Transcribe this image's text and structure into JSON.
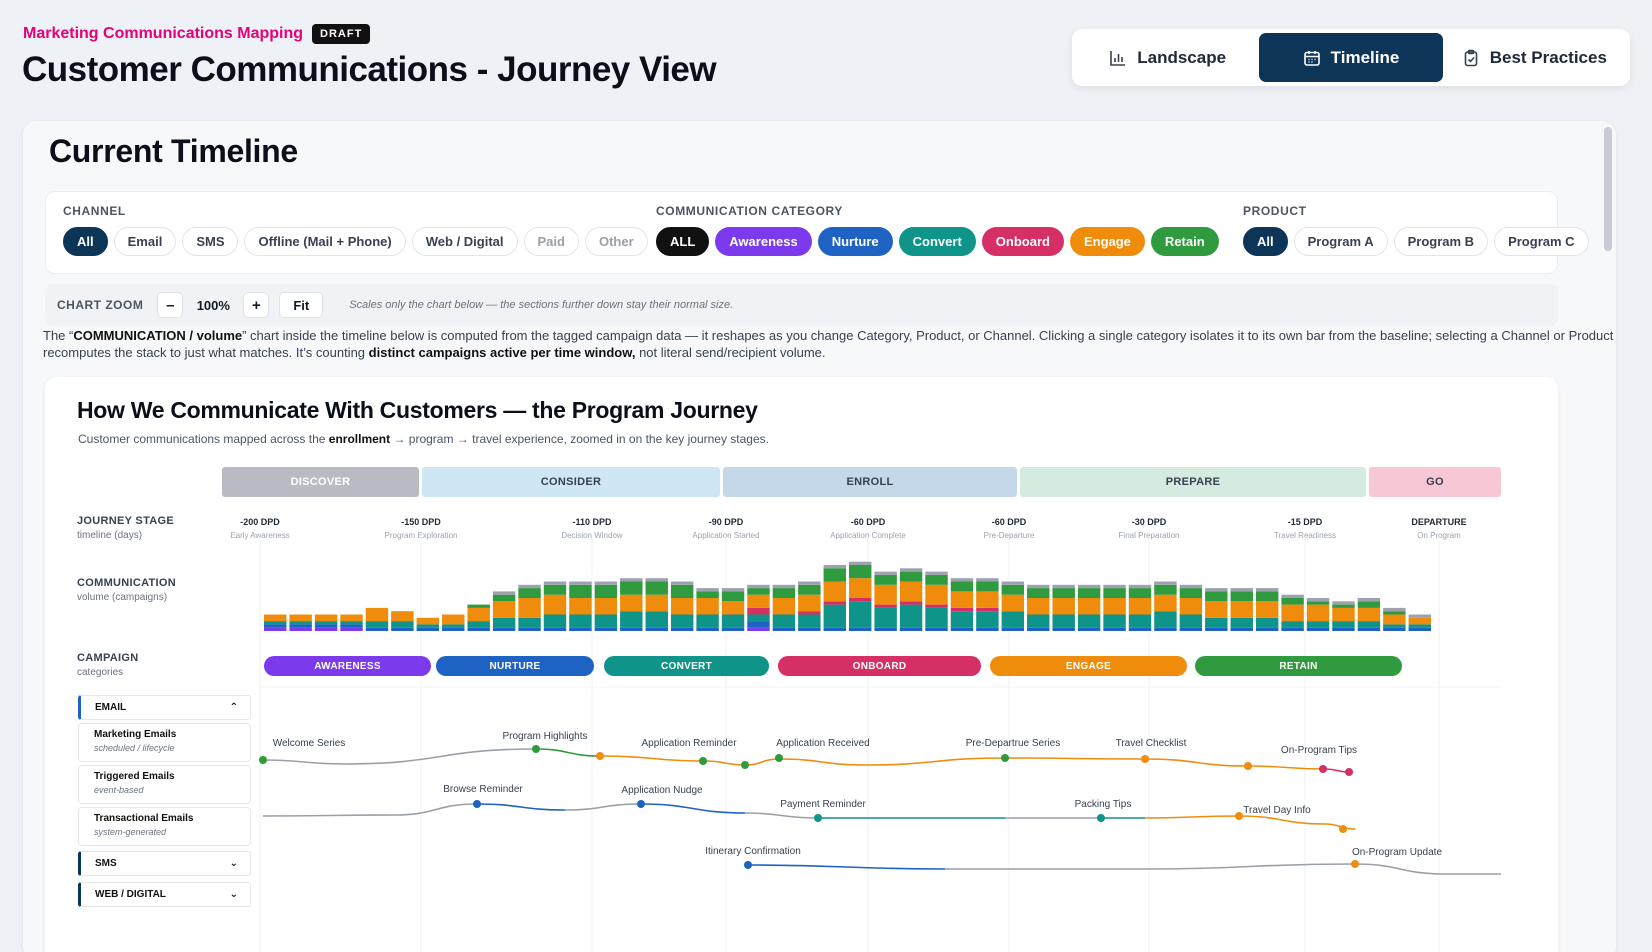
{
  "header": {
    "subtitle": "Marketing Communications Mapping",
    "badge": "DRAFT",
    "title": "Customer Communications - Journey View"
  },
  "views": [
    {
      "label": "Landscape",
      "icon": "bar-chart-icon",
      "active": false
    },
    {
      "label": "Timeline",
      "icon": "calendar-icon",
      "active": true
    },
    {
      "label": "Best Practices",
      "icon": "clipboard-icon",
      "active": false
    }
  ],
  "panel": {
    "title": "Current Timeline"
  },
  "filters": {
    "channel": {
      "label": "CHANNEL",
      "options": [
        "All",
        "Email",
        "SMS",
        "Offline (Mail + Phone)",
        "Web / Digital",
        "Paid",
        "Other"
      ],
      "selected": "All"
    },
    "category": {
      "label": "COMMUNICATION CATEGORY",
      "options": [
        "ALL",
        "Awareness",
        "Nurture",
        "Convert",
        "Onboard",
        "Engage",
        "Retain"
      ],
      "selected": "ALL"
    },
    "product": {
      "label": "PRODUCT",
      "options": [
        "All",
        "Program A",
        "Program B",
        "Program C"
      ],
      "selected": "All"
    }
  },
  "zoom": {
    "label": "CHART ZOOM",
    "minus": "–",
    "value": "100%",
    "plus": "+",
    "fit": "Fit",
    "note": "Scales only the chart below — the sections further down stay their normal size."
  },
  "explain": {
    "p1": "The “",
    "b1": "COMMUNICATION / volume",
    "p2": "” chart inside the timeline below is computed from the tagged campaign data — it reshapes as you change Category, Product, or Channel. Clicking a single category isolates it to its own bar from the baseline; selecting a Channel or Product recomputes the stack to just what matches. It’s counting ",
    "b2": "distinct campaigns active per time window,",
    "p3": " not literal send/recipient volume."
  },
  "chart": {
    "title": "How We Communicate With Customers — the Program Journey",
    "sub_before": "Customer communications mapped across the ",
    "sub_bold": "enrollment",
    "sub_after": " → program → travel experience, zoomed in on the key journey stages.",
    "rows": {
      "journey": {
        "label": "JOURNEY STAGE",
        "sub": "timeline (days)"
      },
      "volume": {
        "label": "COMMUNICATION",
        "sub": "volume (campaigns)"
      },
      "campaign": {
        "label": "CAMPAIGN",
        "sub": "categories"
      }
    },
    "stages": [
      {
        "label": "DISCOVER",
        "bg": "#b8bcc2",
        "fg": "#ffffff"
      },
      {
        "label": "CONSIDER",
        "bg": "#cfe6f5",
        "fg": "#374151"
      },
      {
        "label": "ENROLL",
        "bg": "#c5d8ea",
        "fg": "#374151"
      },
      {
        "label": "PREPARE",
        "bg": "#d5ebe0",
        "fg": "#374151"
      },
      {
        "label": "GO",
        "bg": "#f7c7d6",
        "fg": "#374151"
      }
    ],
    "ticks": [
      {
        "value": "-200 DPD",
        "name": "Early Awareness"
      },
      {
        "value": "-150 DPD",
        "name": "Program Exploration"
      },
      {
        "value": "-110 DPD",
        "name": "Decision Window"
      },
      {
        "value": "-90 DPD",
        "name": "Application Started"
      },
      {
        "value": "-60 DPD",
        "name": "Application Complete"
      },
      {
        "value": "-60 DPD",
        "name": "Pre-Departure"
      },
      {
        "value": "-30 DPD",
        "name": "Final Preparation"
      },
      {
        "value": "-15 DPD",
        "name": "Travel Readiness"
      },
      {
        "value": "DEPARTURE",
        "name": "On Program"
      }
    ],
    "categories": [
      {
        "label": "AWARENESS",
        "color": "#7c3aed"
      },
      {
        "label": "NURTURE",
        "color": "#1e63c4"
      },
      {
        "label": "CONVERT",
        "color": "#0e9488"
      },
      {
        "label": "ONBOARD",
        "color": "#d62f66"
      },
      {
        "label": "ENGAGE",
        "color": "#f08c0c"
      },
      {
        "label": "RETAIN",
        "color": "#2f9a3e"
      }
    ],
    "channels": [
      {
        "label": "EMAIL",
        "open": true,
        "subs": [
          {
            "title": "Marketing Emails",
            "desc": "scheduled / lifecycle"
          },
          {
            "title": "Triggered Emails",
            "desc": "event-based"
          },
          {
            "title": "Transactional Emails",
            "desc": "system-generated"
          }
        ]
      },
      {
        "label": "SMS",
        "open": false,
        "subs": []
      },
      {
        "label": "WEB / DIGITAL",
        "open": false,
        "subs": []
      }
    ],
    "lane_labels": [
      "Welcome Series",
      "Program Highlights",
      "Application Reminder",
      "Application Received",
      "Pre-Departrue Series",
      "Travel Checklist",
      "On-Program Tips",
      "Browse Reminder",
      "Application Nudge",
      "Payment Reminder",
      "Packing Tips",
      "Travel Day Info",
      "Itinerary Confirmation",
      "On-Program Update"
    ]
  },
  "chart_data": {
    "type": "bar",
    "stacked": true,
    "ylabel": "volume (campaigns)",
    "categories_count": 46,
    "series": [
      {
        "name": "Awareness",
        "values": [
          1,
          1,
          1,
          1,
          0,
          0,
          0,
          0,
          0,
          0,
          0,
          0,
          0,
          0,
          0,
          0,
          0,
          0,
          0,
          1,
          0,
          0,
          0,
          0,
          0,
          0,
          0,
          0,
          0,
          0,
          0,
          0,
          0,
          0,
          0,
          0,
          0,
          0,
          0,
          0,
          0,
          0,
          0,
          0,
          0,
          0
        ]
      },
      {
        "name": "Nurture",
        "values": [
          1,
          1,
          1,
          1,
          1,
          1,
          1,
          1,
          1,
          1,
          1,
          1,
          1,
          1,
          1,
          1,
          1,
          1,
          1,
          2,
          1,
          1,
          1,
          1,
          1,
          1,
          1,
          1,
          1,
          1,
          1,
          1,
          1,
          1,
          1,
          1,
          1,
          1,
          1,
          1,
          1,
          1,
          1,
          1,
          1,
          1
        ]
      },
      {
        "name": "Convert",
        "values": [
          1,
          1,
          1,
          1,
          2,
          2,
          1,
          1,
          2,
          3,
          3,
          4,
          4,
          4,
          5,
          5,
          4,
          4,
          4,
          2,
          4,
          4,
          7,
          8,
          6,
          7,
          6,
          5,
          5,
          5,
          4,
          4,
          4,
          4,
          4,
          5,
          4,
          3,
          3,
          3,
          2,
          2,
          2,
          2,
          1,
          1
        ]
      },
      {
        "name": "Onboard",
        "values": [
          0,
          0,
          0,
          0,
          0,
          0,
          0,
          0,
          0,
          0,
          0,
          0,
          0,
          0,
          0,
          0,
          0,
          0,
          0,
          2,
          0,
          1,
          1,
          1,
          1,
          1,
          1,
          1,
          1,
          0,
          0,
          0,
          0,
          0,
          0,
          0,
          0,
          0,
          0,
          0,
          0,
          0,
          0,
          0,
          0,
          0
        ]
      },
      {
        "name": "Engage",
        "values": [
          2,
          2,
          2,
          2,
          4,
          3,
          2,
          3,
          4,
          5,
          6,
          6,
          5,
          5,
          5,
          5,
          5,
          5,
          4,
          4,
          5,
          5,
          6,
          6,
          6,
          6,
          6,
          5,
          5,
          5,
          5,
          5,
          5,
          5,
          5,
          5,
          5,
          5,
          5,
          5,
          5,
          5,
          4,
          4,
          3,
          2
        ]
      },
      {
        "name": "Retain",
        "values": [
          0,
          0,
          0,
          0,
          0,
          0,
          0,
          0,
          1,
          2,
          3,
          3,
          4,
          4,
          4,
          4,
          4,
          2,
          3,
          2,
          3,
          3,
          4,
          4,
          3,
          3,
          3,
          3,
          3,
          3,
          3,
          3,
          3,
          3,
          3,
          3,
          3,
          3,
          3,
          3,
          2,
          1,
          1,
          2,
          1,
          0
        ]
      },
      {
        "name": "Other",
        "values": [
          0,
          0,
          0,
          0,
          0,
          0,
          0,
          0,
          0,
          1,
          1,
          1,
          1,
          1,
          1,
          1,
          1,
          1,
          1,
          1,
          1,
          1,
          1,
          1,
          1,
          1,
          1,
          1,
          1,
          1,
          1,
          1,
          1,
          1,
          1,
          1,
          1,
          1,
          1,
          1,
          1,
          1,
          1,
          1,
          1,
          1
        ]
      }
    ],
    "colors": [
      "#7c3aed",
      "#1e63c4",
      "#0e9488",
      "#d62f66",
      "#f08c0c",
      "#2f9a3e",
      "#9ca3af"
    ]
  }
}
